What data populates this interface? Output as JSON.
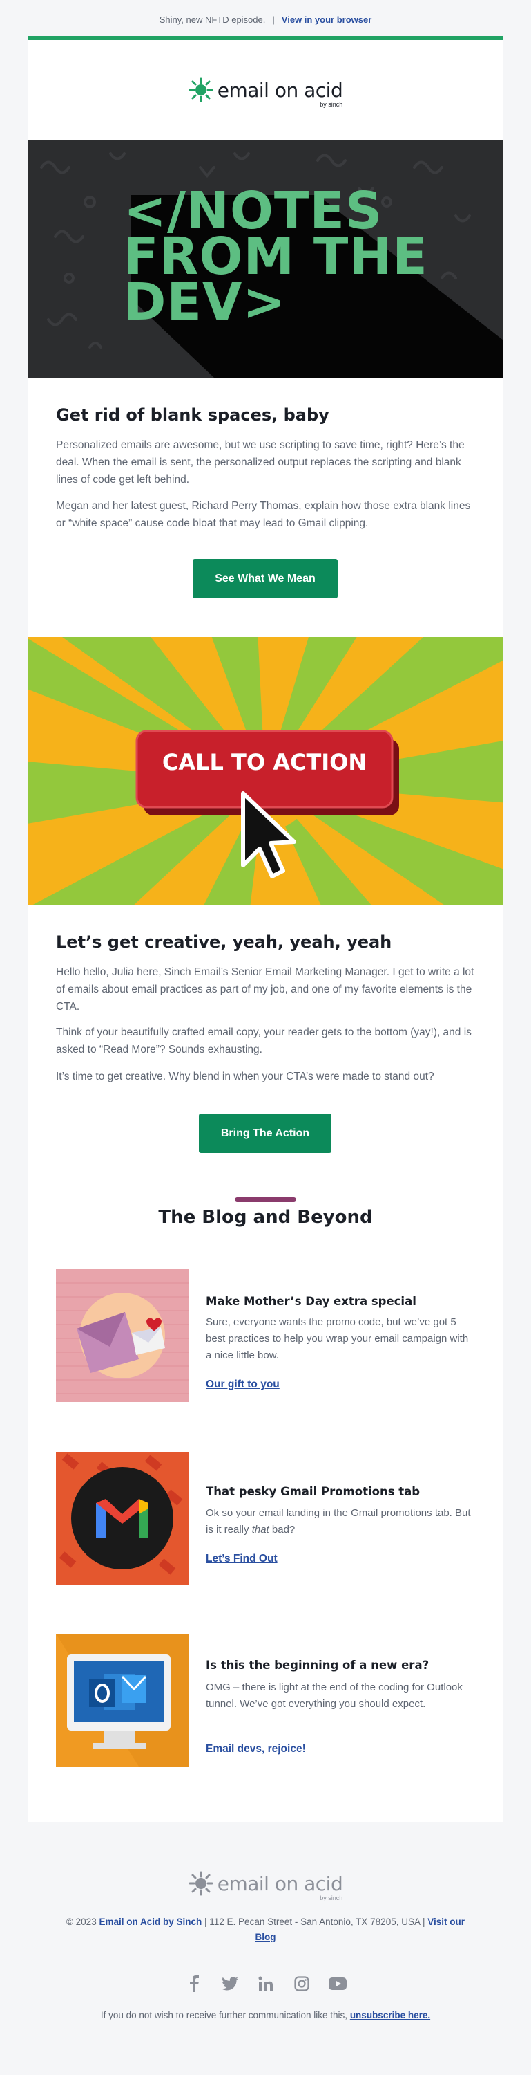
{
  "preheader": {
    "text": "Shiny, new NFTD episode.",
    "separator": "|",
    "view_link": "View in your browser"
  },
  "brand": {
    "name": "email on acid",
    "byline": "by sinch",
    "accent": "#21a364",
    "button_color": "#0c8a5a",
    "heading_color": "#1b1f27",
    "link_color": "#2a4fa0"
  },
  "hero1": {
    "lines": [
      "</NOTES",
      "FROM THE",
      "DEV>"
    ]
  },
  "section1": {
    "title": "Get rid of blank spaces, baby",
    "p1": "Personalized emails are awesome, but we use scripting to save time, right? Here’s the deal. When the email is sent, the personalized output replaces the scripting and blank lines of code get left behind.",
    "p2": "Megan and her latest guest, Richard Perry Thomas, explain how those extra blank lines or “white space” cause code bloat that may lead to Gmail clipping.",
    "button": "See What We Mean"
  },
  "hero2": {
    "cta_text": "CALL TO ACTION"
  },
  "section2": {
    "title": "Let’s get creative, yeah, yeah, yeah",
    "p1": "Hello hello, Julia here, Sinch Email’s Senior Email Marketing Manager. I get to write a lot of emails about email practices as part of my job, and one of my favorite elements is the CTA.",
    "p2": "Think of your beautifully crafted email copy, your reader gets to the bottom (yay!), and is asked to “Read More”? Sounds exhausting.",
    "p3": "It’s time to get creative. Why blend in when your CTA’s were made to stand out?",
    "button": "Bring The Action"
  },
  "blog": {
    "title": "The Blog and Beyond",
    "posts": [
      {
        "title": "Make Mother’s Day extra special",
        "desc": "Sure, everyone wants the promo code, but we’ve got 5 best practices to help you wrap your email campaign with a nice little bow.",
        "link": "Our gift to you",
        "icon": "envelope-heart-icon"
      },
      {
        "title": "That pesky Gmail Promotions tab",
        "desc_a": "Ok so your email landing in the Gmail promotions tab. But is it really ",
        "desc_em": "that",
        "desc_b": " bad?",
        "link": "Let’s Find Out",
        "icon": "gmail-icon"
      },
      {
        "title": "Is this the beginning of a new era?",
        "desc": "OMG – there is light at the end of the coding for Outlook tunnel. We’ve got everything you should expect.",
        "link": "Email devs, rejoice!",
        "icon": "outlook-monitor-icon"
      }
    ]
  },
  "footer": {
    "copyright": "© 2023",
    "company_link": "Email on Acid by Sinch",
    "address": "| 112 E. Pecan Street - San Antonio, TX 78205, USA |",
    "blog_link": "Visit our Blog",
    "social": [
      "facebook-icon",
      "twitter-icon",
      "linkedin-icon",
      "instagram-icon",
      "youtube-icon"
    ],
    "unsub_text": "If you do not wish to receive further communication like this,",
    "unsub_link": "unsubscribe here."
  }
}
